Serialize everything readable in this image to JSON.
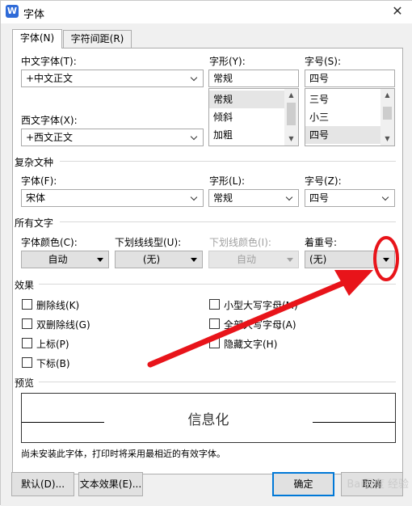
{
  "window": {
    "title": "字体",
    "app_icon_letter": "W",
    "close_glyph": "✕"
  },
  "tabs": [
    {
      "label": "字体(N)",
      "active": true
    },
    {
      "label": "字符间距(R)",
      "active": false
    }
  ],
  "chinese_font": {
    "label": "中文字体(T):",
    "value": "+中文正文"
  },
  "western_font": {
    "label": "西文字体(X):",
    "value": "+西文正文"
  },
  "style": {
    "label": "字形(Y):",
    "value": "常规",
    "options": [
      "常规",
      "倾斜",
      "加粗"
    ],
    "selected_index": 0
  },
  "size": {
    "label": "字号(S):",
    "value": "四号",
    "options": [
      "三号",
      "小三",
      "四号"
    ],
    "selected_index": 2
  },
  "complex": {
    "section_title": "复杂文种",
    "font_label": "字体(F):",
    "font_value": "宋体",
    "style_label": "字形(L):",
    "style_value": "常规",
    "size_label": "字号(Z):",
    "size_value": "四号"
  },
  "all_text": {
    "section_title": "所有文字",
    "font_color_label": "字体颜色(C):",
    "font_color_value": "自动",
    "underline_type_label": "下划线线型(U):",
    "underline_type_value": "(无)",
    "underline_color_label": "下划线颜色(I):",
    "underline_color_value": "自动",
    "emphasis_label": "着重号:",
    "emphasis_value": "(无)"
  },
  "effects": {
    "section_title": "效果",
    "left": [
      "删除线(K)",
      "双删除线(G)",
      "上标(P)",
      "下标(B)"
    ],
    "right": [
      "小型大写字母(M)",
      "全部大写字母(A)",
      "隐藏文字(H)"
    ]
  },
  "preview": {
    "section_title": "预览",
    "sample_text": "信息化",
    "note": "尚未安装此字体，打印时将采用最相近的有效字体。"
  },
  "buttons": {
    "default": "默认(D)...",
    "text_effects": "文本效果(E)...",
    "ok": "确定",
    "cancel": "取消"
  },
  "annotation": {
    "color": "#e8141a"
  },
  "watermark": {
    "text": "Bai百度 经验"
  },
  "colors": {
    "accent": "#0078d7",
    "dialog_bg": "#f0f0f0",
    "panel_bg": "#ffffff"
  }
}
